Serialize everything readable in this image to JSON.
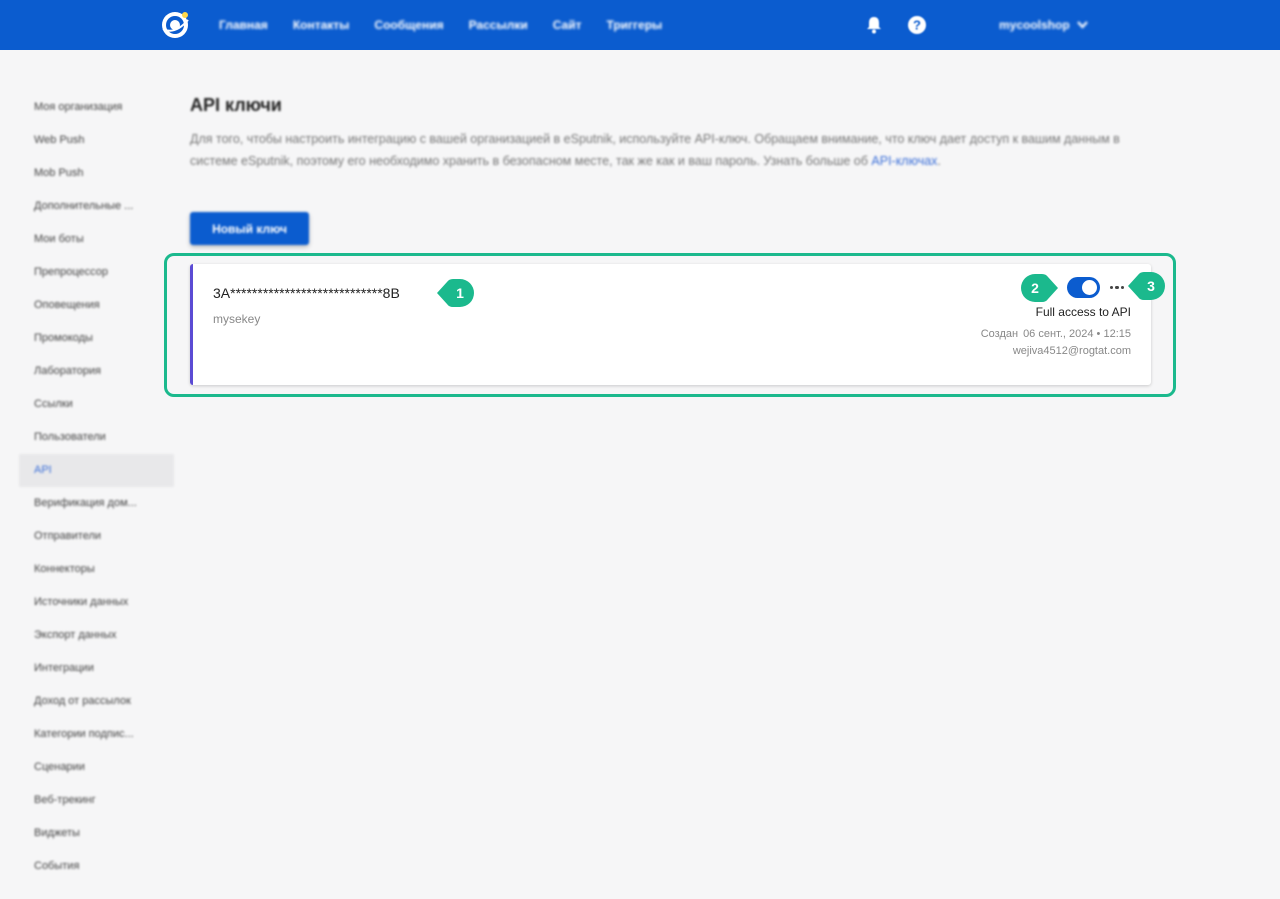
{
  "app": {
    "logo_icon": "esputnik-logo",
    "brand_color": "#0b5ccf",
    "highlight_color": "#1bb98d"
  },
  "nav": {
    "items": [
      "Главная",
      "Контакты",
      "Сообщения",
      "Рассылки",
      "Сайт",
      "Триггеры"
    ],
    "notification_icon": "bell-icon",
    "help_icon": "question-circle-icon",
    "account": "mycoolshop"
  },
  "sidebar": {
    "items": [
      "Моя организация",
      "Web Push",
      "Mob Push",
      "Дополнительные ...",
      "Мои боты",
      "Препроцессор",
      "Оповещения",
      "Промокоды",
      "Лаборатория",
      "Ссылки",
      "Пользователи",
      "API",
      "Верификация дом...",
      "Отправители",
      "Коннекторы",
      "Источники данных",
      "Экспорт данных",
      "Интеграции",
      "Доход от рассылок",
      "Категории подпис...",
      "Сценарии",
      "Веб-трекинг",
      "Виджеты",
      "События"
    ],
    "active_index": 11
  },
  "page": {
    "title": "API ключи",
    "description": "Для того, чтобы настроить интеграцию с вашей организацией в eSputnik, используйте API-ключ. Обращаем внимание, что ключ дает доступ к вашим данным в системе eSputnik, поэтому его необходимо хранить в безопасном месте, так же как и ваш пароль. Узнать больше об",
    "description_link": "API-ключах",
    "description_end": ".",
    "new_key_button": "Новый ключ"
  },
  "key_card": {
    "key_masked": "3A****************************8B",
    "name": "mysekey",
    "enabled": true,
    "access": "Full access to API",
    "created_label": "Создан",
    "created_date": "06 сент., 2024 • 12:15",
    "created_by": "wejiva4512@rogtat.com"
  },
  "callouts": {
    "one": "1",
    "two": "2",
    "three": "3"
  }
}
